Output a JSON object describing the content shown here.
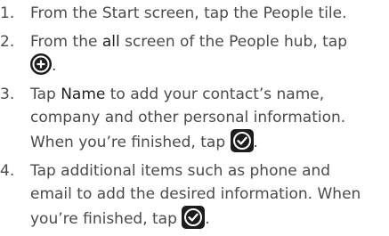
{
  "steps": [
    {
      "num": "1.",
      "line1": "From the Start screen, tap the People tile."
    },
    {
      "num": "2.",
      "line1_pre": "From the ",
      "line1_bold": "all",
      "line1_post": " screen of the People hub, tap",
      "icon": "add-circle-icon",
      "end": "."
    },
    {
      "num": "3.",
      "line1_pre": "Tap ",
      "line1_bold": "Name",
      "line1_post": " to add your contact’s name,",
      "line2": "company and other personal information.",
      "line3_pre": "When you’re finished, tap ",
      "icon": "checkmark-icon",
      "end": "."
    },
    {
      "num": "4.",
      "line1": "Tap additional items such as phone and",
      "line2": "email to add the desired information. When",
      "line3_pre": "you’re finished, tap ",
      "icon": "checkmark-icon",
      "end": "."
    }
  ],
  "colors": {
    "text": "#4a4a4a",
    "icon_bg": "#1c1c1c",
    "icon_fg": "#ffffff"
  }
}
